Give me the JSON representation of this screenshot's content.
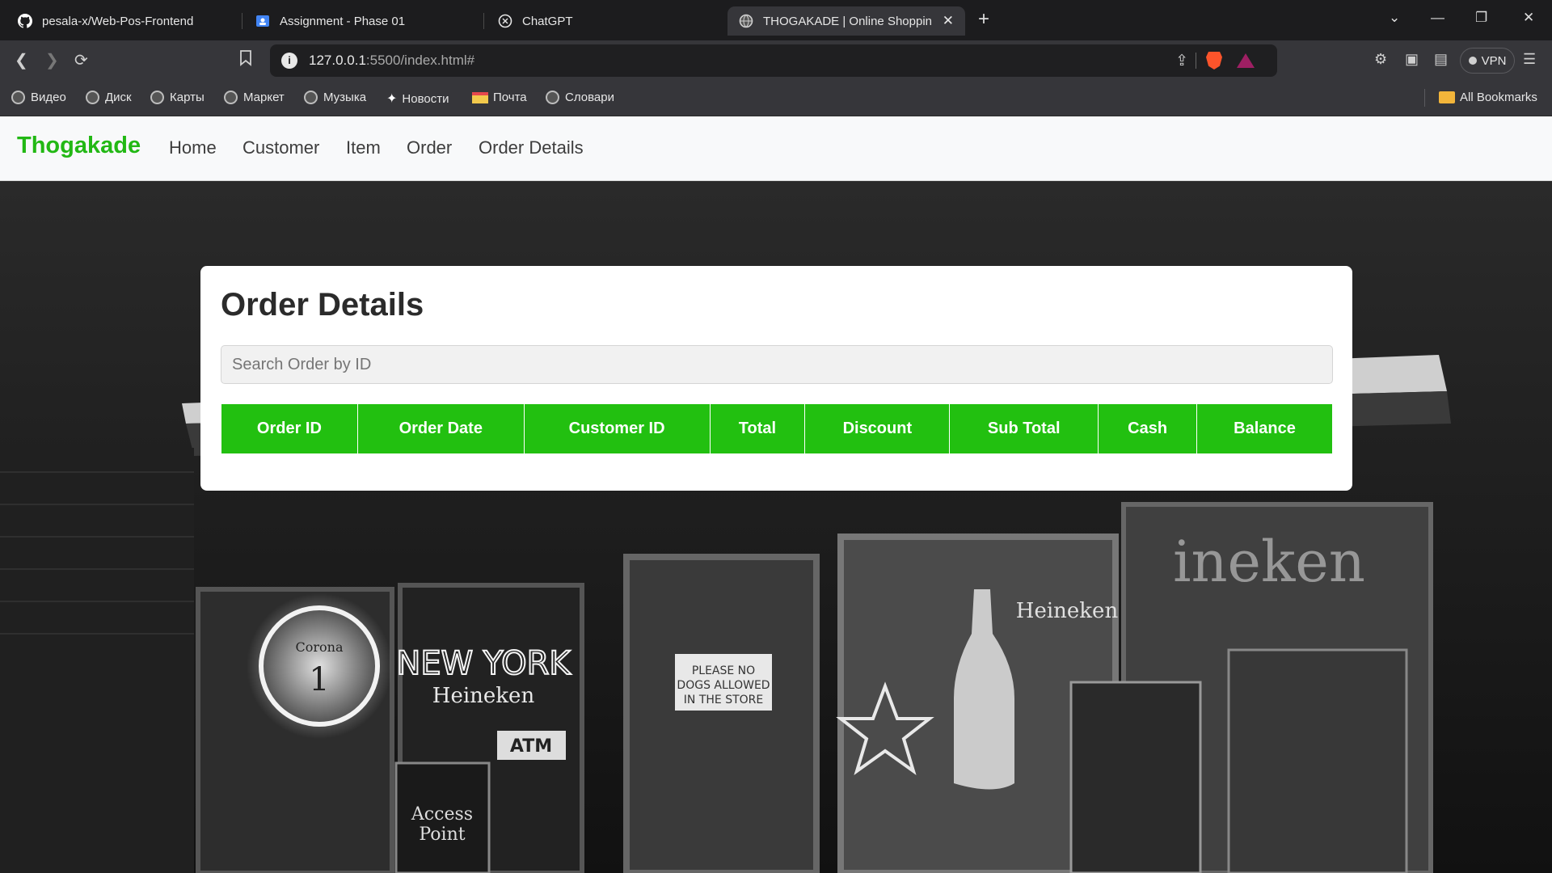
{
  "browser": {
    "tabs": [
      {
        "title": "pesala-x/Web-Pos-Frontend",
        "icon": "github-icon",
        "active": false
      },
      {
        "title": "Assignment - Phase 01",
        "icon": "classroom-icon",
        "active": false
      },
      {
        "title": "ChatGPT",
        "icon": "chatgpt-icon",
        "active": false
      },
      {
        "title": "THOGAKADE | Online Shopping",
        "icon": "globe-icon",
        "active": true
      }
    ],
    "new_tab": "+",
    "url_host": "127.0.0.1",
    "url_rest": ":5500/index.html#",
    "vpn_label": "VPN",
    "bookmarks": [
      {
        "label": "Видео",
        "icon": "globe-icon"
      },
      {
        "label": "Диск",
        "icon": "globe-icon"
      },
      {
        "label": "Карты",
        "icon": "globe-icon"
      },
      {
        "label": "Маркет",
        "icon": "globe-icon"
      },
      {
        "label": "Музыка",
        "icon": "globe-icon"
      },
      {
        "label": "Новости",
        "icon": "spark-icon"
      },
      {
        "label": "Почта",
        "icon": "mail-icon"
      },
      {
        "label": "Словари",
        "icon": "globe-icon"
      }
    ],
    "all_bookmarks": "All Bookmarks"
  },
  "site": {
    "brand": "Thogakade",
    "nav": [
      "Home",
      "Customer",
      "Item",
      "Order",
      "Order Details"
    ],
    "brand_color": "#22b814"
  },
  "order_details": {
    "title": "Order Details",
    "search_placeholder": "Search Order by ID",
    "columns": [
      "Order ID",
      "Order Date",
      "Customer ID",
      "Total",
      "Discount",
      "Sub Total",
      "Cash",
      "Balance"
    ],
    "rows": [],
    "header_color": "#22c010"
  }
}
